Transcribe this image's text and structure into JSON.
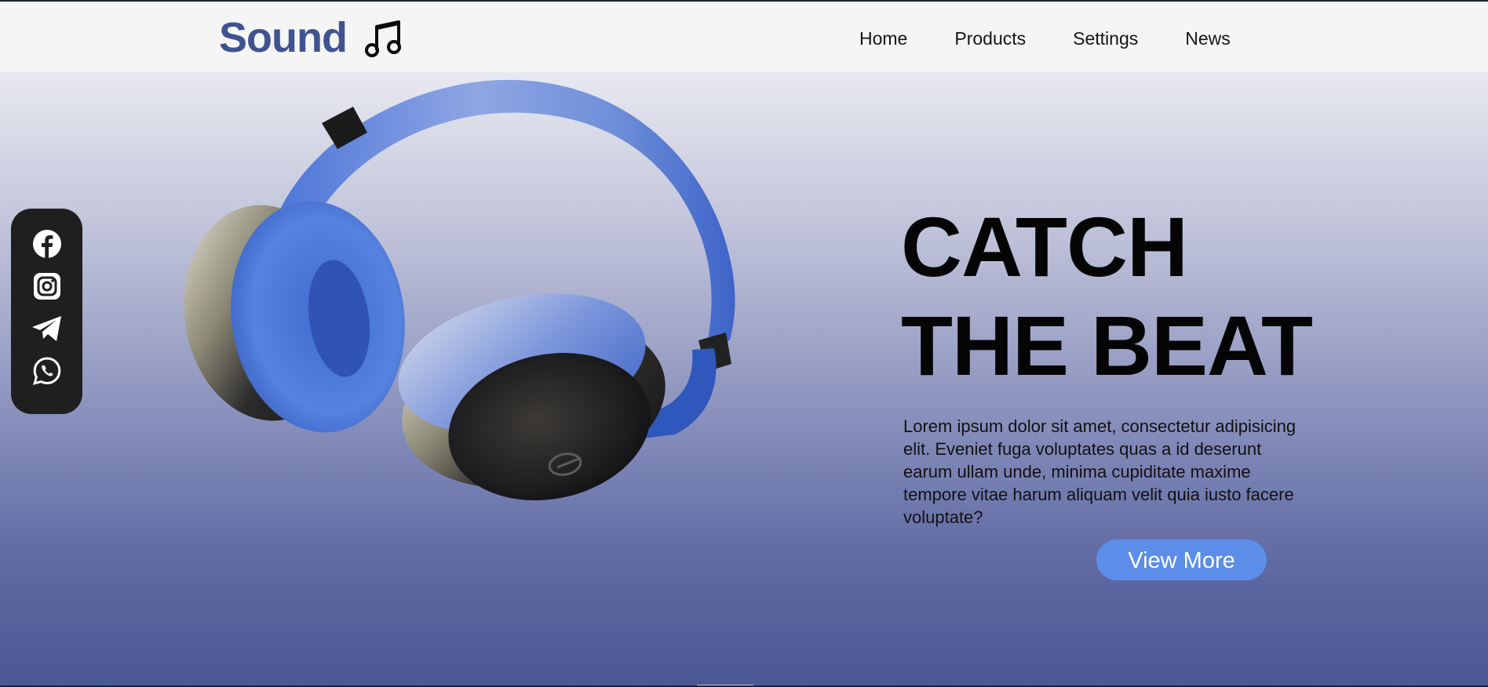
{
  "brand": {
    "name": "Sound",
    "logo_icon": "music-note-icon",
    "color": "#3e5390"
  },
  "nav": {
    "items": [
      {
        "label": "Home"
      },
      {
        "label": "Products"
      },
      {
        "label": "Settings"
      },
      {
        "label": "News"
      }
    ]
  },
  "social": {
    "icons": [
      "facebook-icon",
      "instagram-icon",
      "telegram-icon",
      "whatsapp-icon"
    ],
    "background": "#1f1f1f"
  },
  "hero": {
    "title_line1": "CATCH",
    "title_line2": "THE BEAT",
    "description": "Lorem ipsum dolor sit amet, consectetur adipisicing elit. Eveniet fuga voluptates quas a id deserunt earum ullam unde, minima cupiditate maxime tempore vitae harum aliquam velit quia iusto facere voluptate?",
    "button_label": "View More",
    "button_color": "#5c8ee9",
    "image": "headphones-image"
  }
}
